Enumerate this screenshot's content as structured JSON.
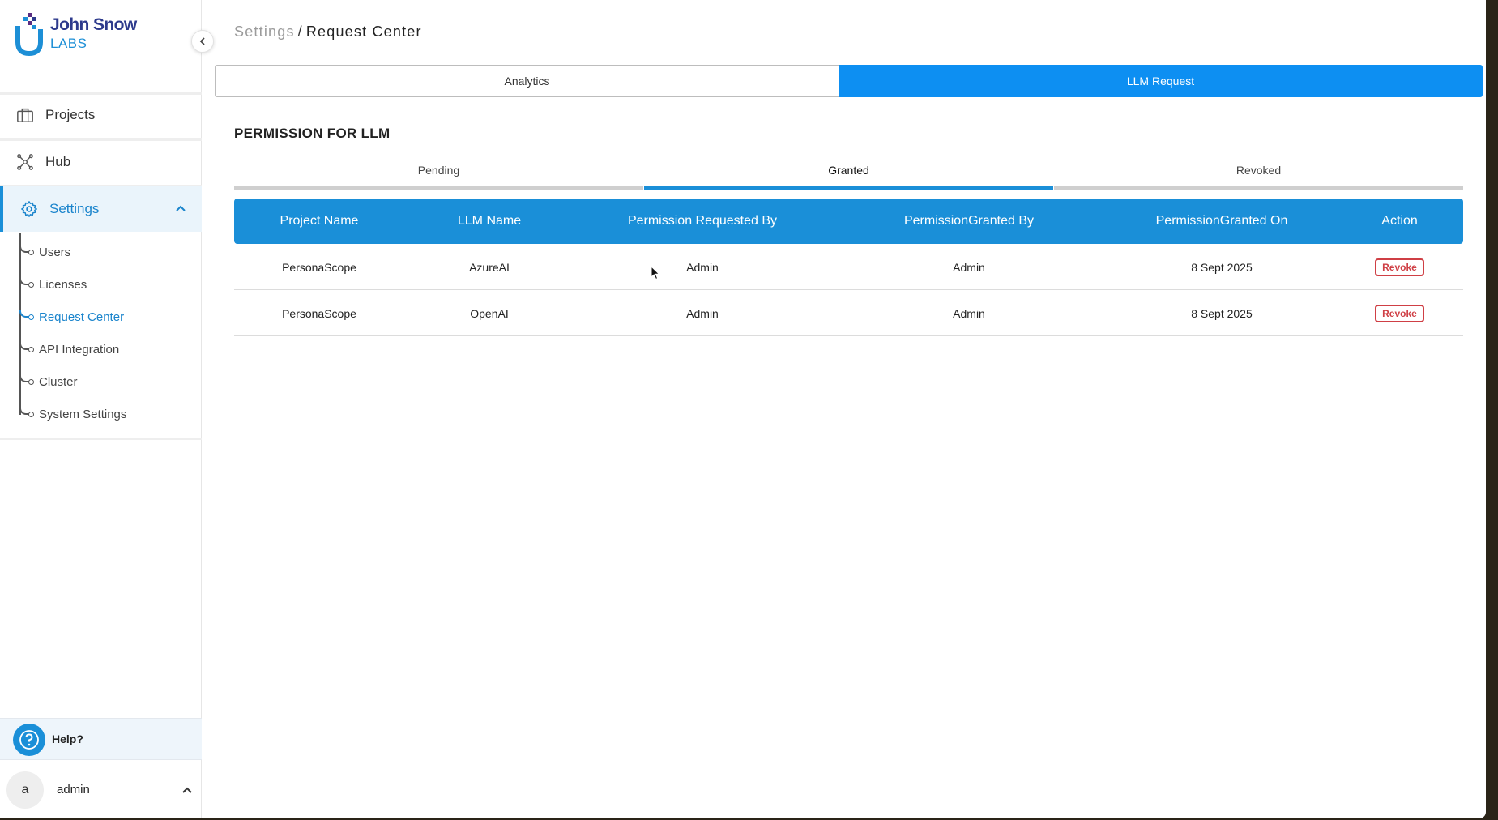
{
  "brand": {
    "line1": "John Snow",
    "line2": "LABS"
  },
  "sidebar": {
    "items": [
      {
        "label": "Projects",
        "icon": "briefcase-icon"
      },
      {
        "label": "Hub",
        "icon": "network-hub-icon"
      },
      {
        "label": "Settings",
        "icon": "gear-icon",
        "active": true,
        "expanded": true
      }
    ],
    "settings_subitems": [
      {
        "label": "Users"
      },
      {
        "label": "Licenses"
      },
      {
        "label": "Request Center",
        "active": true
      },
      {
        "label": "API Integration"
      },
      {
        "label": "Cluster"
      },
      {
        "label": "System Settings"
      }
    ],
    "help_label": "Help?",
    "user": {
      "avatar_letter": "a",
      "name": "admin"
    }
  },
  "breadcrumb": {
    "parent": "Settings",
    "separator": "/",
    "current": "Request Center"
  },
  "top_tabs": [
    {
      "label": "Analytics",
      "active": false
    },
    {
      "label": "LLM Request",
      "active": true
    }
  ],
  "section_title": "PERMISSION FOR LLM",
  "status_tabs": [
    {
      "label": "Pending",
      "active": false
    },
    {
      "label": "Granted",
      "active": true
    },
    {
      "label": "Revoked",
      "active": false
    }
  ],
  "table": {
    "headers": [
      "Project Name",
      "LLM Name",
      "Permission Requested By",
      "PermissionGranted By",
      "PermissionGranted On",
      "Action"
    ],
    "rows": [
      {
        "project": "PersonaScope",
        "llm": "AzureAI",
        "requested_by": "Admin",
        "granted_by": "Admin",
        "granted_on": "8 Sept 2025",
        "action": "Revoke"
      },
      {
        "project": "PersonaScope",
        "llm": "OpenAI",
        "requested_by": "Admin",
        "granted_by": "Admin",
        "granted_on": "8 Sept 2025",
        "action": "Revoke"
      }
    ]
  },
  "colors": {
    "accent": "#1a8fd8",
    "tab_active": "#0d8ff2",
    "danger": "#cf3f45",
    "brand_navy": "#2d3a8c"
  }
}
